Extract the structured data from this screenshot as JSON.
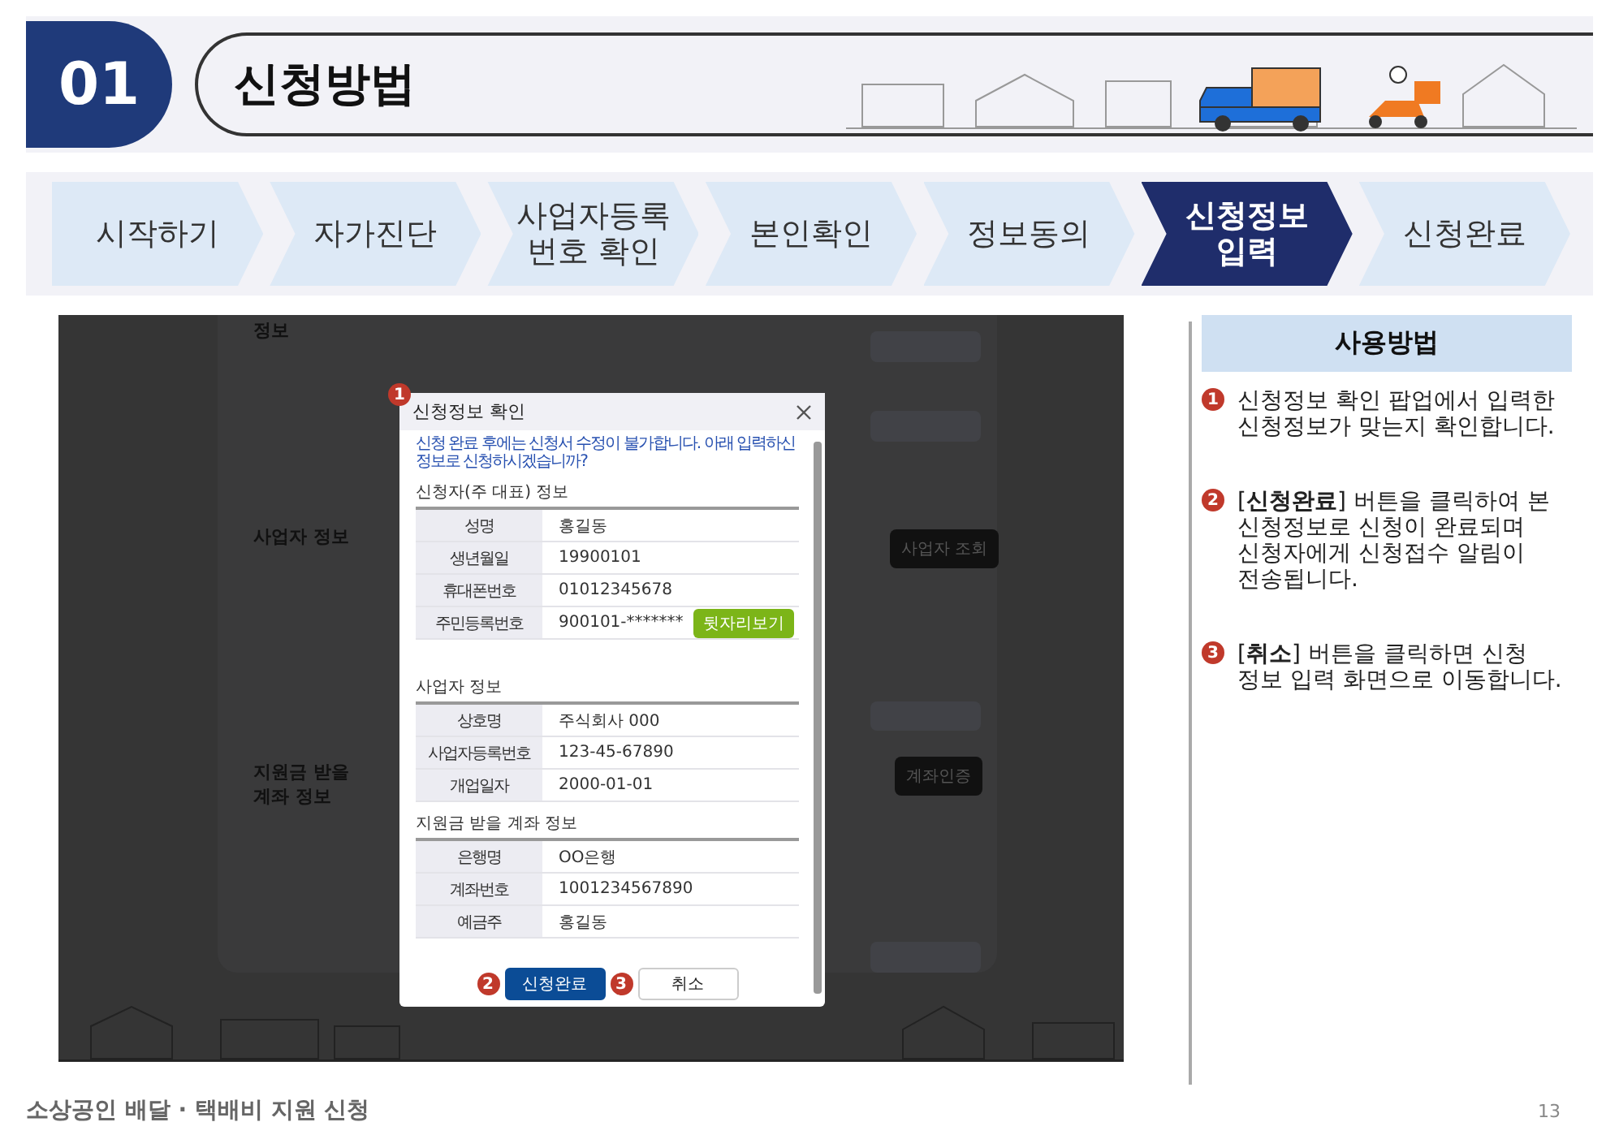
{
  "header": {
    "number": "01",
    "title": "신청방법"
  },
  "steps": [
    {
      "label": "시작하기",
      "selected": false
    },
    {
      "label": "자가진단",
      "selected": false
    },
    {
      "label": "사업자등록\n번호 확인",
      "selected": false
    },
    {
      "label": "본인확인",
      "selected": false
    },
    {
      "label": "정보동의",
      "selected": false
    },
    {
      "label": "신청정보\n입력",
      "selected": true
    },
    {
      "label": "신청완료",
      "selected": false
    }
  ],
  "screenshot": {
    "background_labels": [
      "정보",
      "사업자 정보",
      "지원금 받을\n계좌 정보"
    ],
    "background_buttons": [
      "사업자 조회",
      "계좌인증"
    ],
    "popup": {
      "title": "신청정보 확인",
      "notice": "신청 완료 후에는 신청서 수정이 불가합니다. 아래 입력하신 정보로 신청하시겠습니까?",
      "sections": [
        {
          "title": "신청자(주 대표) 정보",
          "rows": [
            {
              "label": "성명",
              "value": "홍길동"
            },
            {
              "label": "생년월일",
              "value": "19900101"
            },
            {
              "label": "휴대폰번호",
              "value": "01012345678"
            },
            {
              "label": "주민등록번호",
              "value": "900101-*******",
              "button": "뒷자리보기"
            }
          ]
        },
        {
          "title": "사업자 정보",
          "rows": [
            {
              "label": "상호명",
              "value": "주식회사 000"
            },
            {
              "label": "사업자등록번호",
              "value": "123-45-67890"
            },
            {
              "label": "개업일자",
              "value": "2000-01-01"
            }
          ]
        },
        {
          "title": "지원금 받을 계좌 정보",
          "rows": [
            {
              "label": "은행명",
              "value": "OO은행"
            },
            {
              "label": "계좌번호",
              "value": "1001234567890"
            },
            {
              "label": "예금주",
              "value": "홍길동"
            }
          ]
        }
      ],
      "buttons": [
        {
          "label": "신청완료",
          "kind": "primary",
          "marker": "2"
        },
        {
          "label": "취소",
          "kind": "secondary",
          "marker": "3"
        }
      ],
      "marker": "1"
    }
  },
  "usage": {
    "title": "사용방법",
    "items": [
      {
        "marker": "1",
        "text": "신청정보 확인 팝업에서 입력한 신청정보가 맞는지 확인합니다."
      },
      {
        "marker": "2",
        "text": "[**신청완료**] 버튼을 클릭하여 본 신청정보로 신청이 완료되며 신청자에게 신청접수 알림이 전송됩니다."
      },
      {
        "marker": "3",
        "text": "[**취소**] 버튼을 클릭하면 신청 정보 입력 화면으로 이동합니다."
      }
    ]
  },
  "footer": {
    "title": "소상공인 배달 · 택배비 지원 신청",
    "page": "13"
  }
}
